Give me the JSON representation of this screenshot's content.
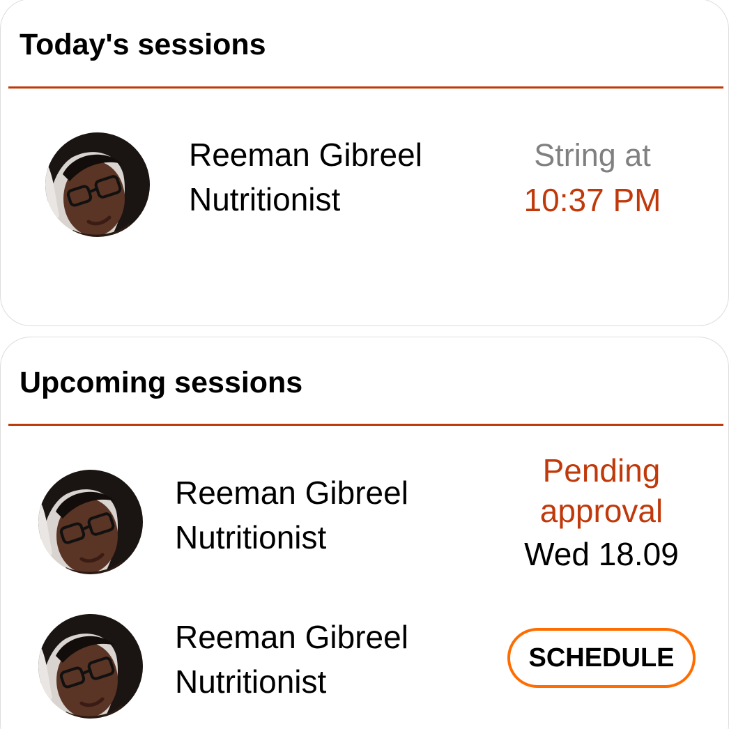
{
  "theme": {
    "accent": "#c0390b",
    "button_border": "#ff6d00",
    "muted": "#808080",
    "text": "#000000"
  },
  "today": {
    "title": "Today's sessions",
    "sessions": [
      {
        "avatar_icon": "profile-photo-icon",
        "name": "Reeman Gibreel",
        "role": "Nutritionist",
        "status_label": "String at",
        "time": "10:37 PM"
      }
    ]
  },
  "upcoming": {
    "title": "Upcoming sessions",
    "sessions": [
      {
        "avatar_icon": "profile-photo-icon",
        "name": "Reeman Gibreel",
        "role": "Nutritionist",
        "status_line1": "Pending",
        "status_line2": "approval",
        "date": "Wed 18.09"
      },
      {
        "avatar_icon": "profile-photo-icon",
        "name": "Reeman Gibreel",
        "role": "Nutritionist",
        "action_label": "SCHEDULE"
      }
    ]
  }
}
